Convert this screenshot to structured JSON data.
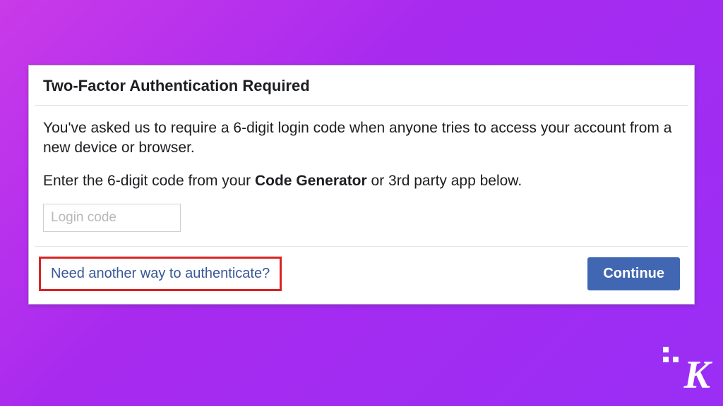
{
  "dialog": {
    "title": "Two-Factor Authentication Required",
    "body": {
      "line1": "You've asked us to require a 6-digit login code when anyone tries to access your account from a new device or browser.",
      "line2_prefix": "Enter the 6-digit code from your ",
      "line2_bold": "Code Generator",
      "line2_suffix": " or 3rd party app below."
    },
    "input": {
      "placeholder": "Login code",
      "value": ""
    },
    "footer": {
      "alt_link": "Need another way to authenticate?",
      "continue_label": "Continue"
    }
  },
  "watermark": {
    "letter": "K"
  }
}
